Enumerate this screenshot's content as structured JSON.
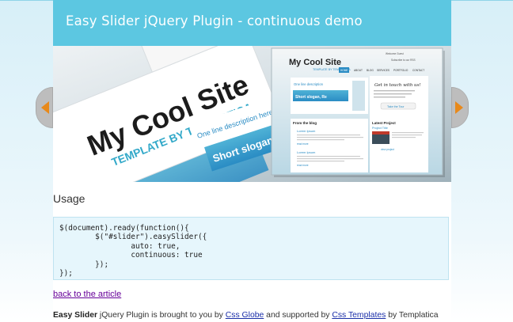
{
  "header": {
    "title": "Easy Slider jQuery Plugin - continuous demo"
  },
  "slide": {
    "big_title": "My Cool Site",
    "big_subtitle": "TEMPLATE BY TEMPLATICA",
    "big_card_slogan": "Short slogan, Re",
    "big_card_tagline": "One line description here",
    "mini": {
      "title": "My Cool Site",
      "subtitle": "TEMPLATE BY TEMPLATICA",
      "top_links": [
        "Welcome Guest",
        "Subscribe to our RSS"
      ],
      "nav": [
        "HOME",
        "ABOUT",
        "BLOG",
        "SERVICES",
        "PORTFOLIO",
        "CONTACT"
      ],
      "banner_heading": "One line description",
      "slogan": "Short slogan, Re",
      "get_in_touch": "Get in touch with us!",
      "take_tour": "Take the Tour",
      "from_blog": "From the blog",
      "post_title": "Lorem Ipsum",
      "read_more": "read more",
      "latest_project": "Latest Project",
      "project_title": "Project Title",
      "view_project": "view project"
    },
    "colors": {
      "accent_blue": "#2a8cc4",
      "teal": "#33a9c9"
    }
  },
  "nav": {
    "prev_icon": "arrow-left-icon",
    "next_icon": "arrow-right-icon",
    "arrow_color": "#e8891a"
  },
  "usage": {
    "title": "Usage",
    "code": "$(document).ready(function(){\n\t$(\"#slider\").easySlider({\n\t\tauto: true,\n\t\tcontinuous: true\n\t});\n});"
  },
  "back_link": "back to the article",
  "credits": {
    "product": "Easy Slider",
    "text1": " jQuery Plugin is brought to you by ",
    "link1": "Css Globe",
    "text2": " and supported by ",
    "link2": "Css Templates",
    "text3": " by Templatica"
  }
}
